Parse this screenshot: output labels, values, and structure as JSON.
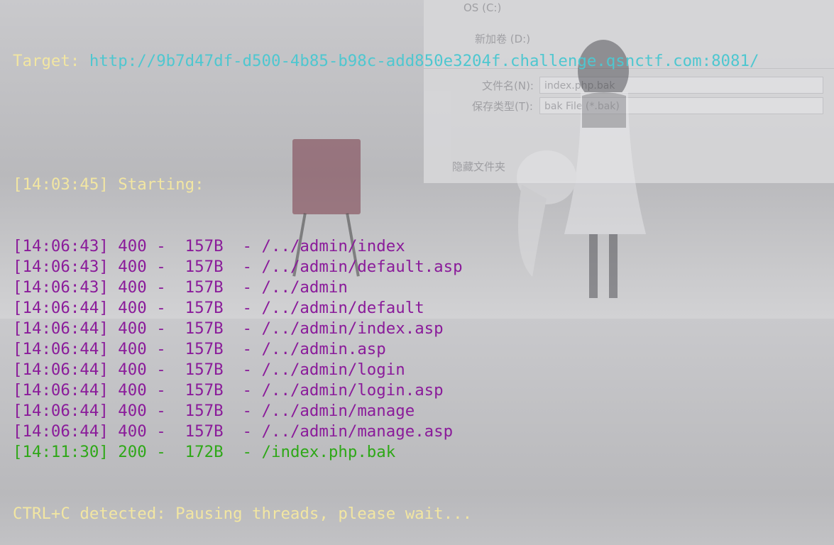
{
  "background_dialog": {
    "drive_os": "OS (C:)",
    "drive_new": "新加卷 (D:)",
    "filename_label": "文件名(N):",
    "filename_value": "index.php.bak",
    "filetype_label": "保存类型(T):",
    "filetype_value": "bak File (*.bak)",
    "hide_folders": "隐藏文件夹"
  },
  "terminal": {
    "target_label": "Target: ",
    "target_url": "http://9b7d47df-d500-4b85-b98c-add850e3204f.challenge.qsnctf.com:8081/",
    "start_line": "[14:03:45] Starting:",
    "results": [
      {
        "time": "[14:06:43]",
        "status": "400",
        "size": "157B",
        "path": "/../admin/index",
        "color": "#8a1b9a"
      },
      {
        "time": "[14:06:43]",
        "status": "400",
        "size": "157B",
        "path": "/../admin/default.asp",
        "color": "#8a1b9a"
      },
      {
        "time": "[14:06:43]",
        "status": "400",
        "size": "157B",
        "path": "/../admin",
        "color": "#8a1b9a"
      },
      {
        "time": "[14:06:44]",
        "status": "400",
        "size": "157B",
        "path": "/../admin/default",
        "color": "#8a1b9a"
      },
      {
        "time": "[14:06:44]",
        "status": "400",
        "size": "157B",
        "path": "/../admin/index.asp",
        "color": "#8a1b9a"
      },
      {
        "time": "[14:06:44]",
        "status": "400",
        "size": "157B",
        "path": "/../admin.asp",
        "color": "#8a1b9a"
      },
      {
        "time": "[14:06:44]",
        "status": "400",
        "size": "157B",
        "path": "/../admin/login",
        "color": "#8a1b9a"
      },
      {
        "time": "[14:06:44]",
        "status": "400",
        "size": "157B",
        "path": "/../admin/login.asp",
        "color": "#8a1b9a"
      },
      {
        "time": "[14:06:44]",
        "status": "400",
        "size": "157B",
        "path": "/../admin/manage",
        "color": "#8a1b9a"
      },
      {
        "time": "[14:06:44]",
        "status": "400",
        "size": "157B",
        "path": "/../admin/manage.asp",
        "color": "#8a1b9a"
      },
      {
        "time": "[14:11:30]",
        "status": "200",
        "size": "172B",
        "path": "/index.php.bak",
        "color": "#2ea817"
      }
    ],
    "ctrl_c_line": "CTRL+C detected: Pausing threads, please wait..."
  },
  "colors": {
    "yellow": "#f2e6a2",
    "cyan": "#4ec7d0",
    "purple": "#8a1b9a",
    "green": "#2ea817"
  }
}
